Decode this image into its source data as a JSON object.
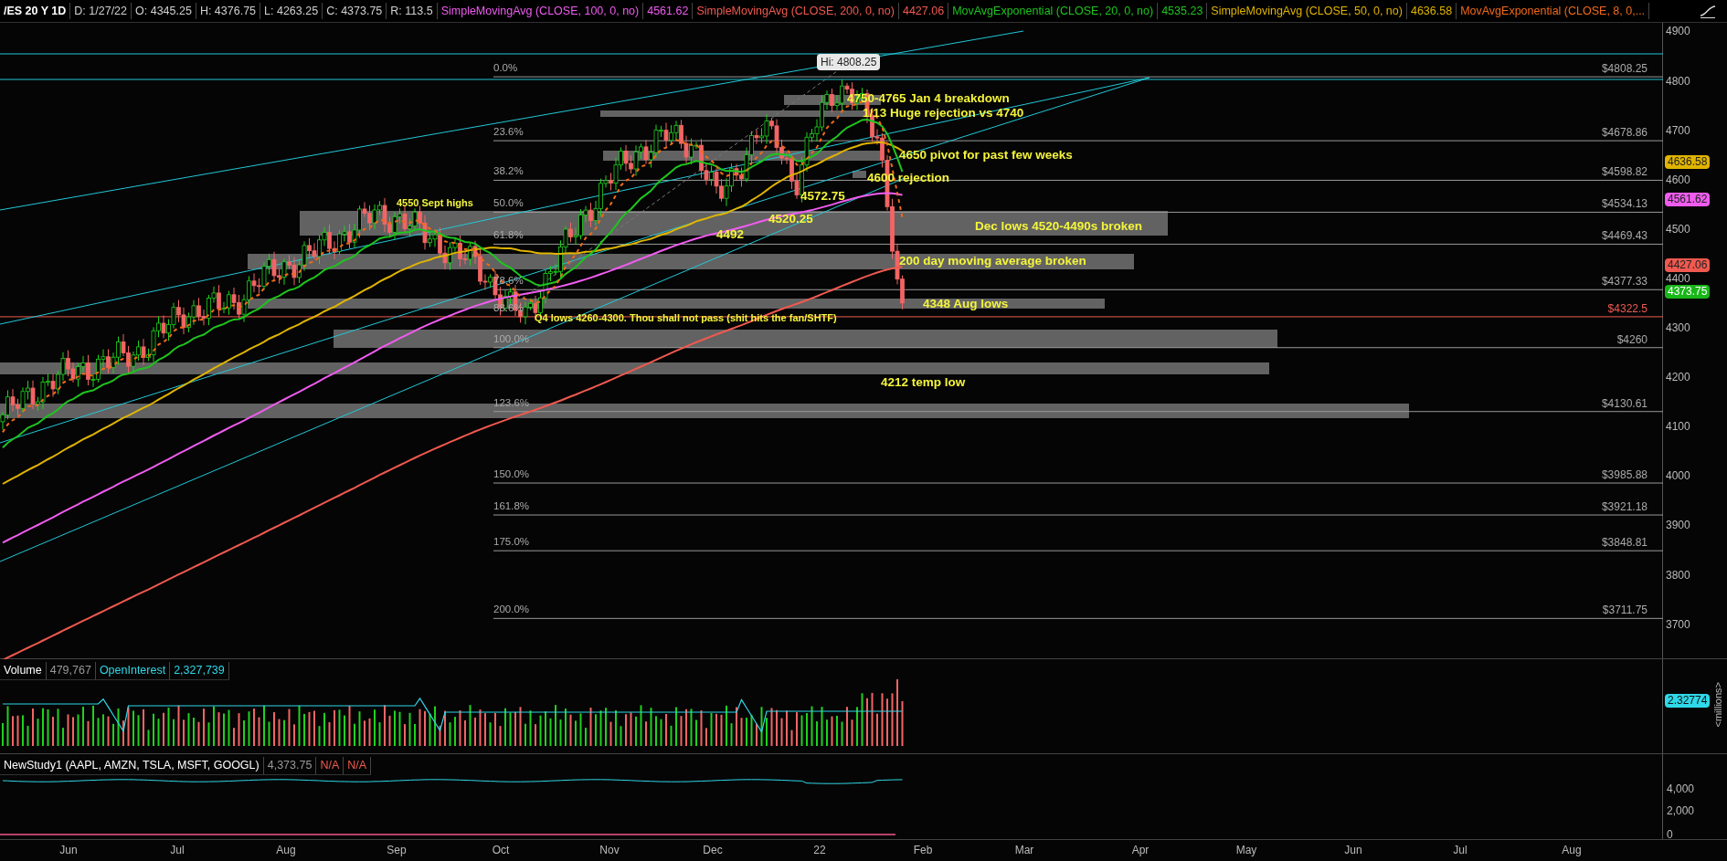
{
  "header": {
    "symbol": "/ES 20 Y 1D",
    "fields": [
      "D: 1/27/22",
      "O: 4345.25",
      "H: 4376.75",
      "L: 4263.25",
      "C: 4373.75",
      "R: 113.5"
    ],
    "studies": [
      {
        "name": "SimpleMovingAvg (CLOSE, 100, 0, no)",
        "value": "4561.62",
        "color": "#f05cf0"
      },
      {
        "name": "SimpleMovingAvg (CLOSE, 200, 0, no)",
        "value": "4427.06",
        "color": "#f0594f"
      },
      {
        "name": "MovAvgExponential (CLOSE, 20, 0, no)",
        "value": "4535.23",
        "color": "#1ec41e"
      },
      {
        "name": "SimpleMovingAvg (CLOSE, 50, 0, no)",
        "value": "4636.58",
        "color": "#e0b400"
      },
      {
        "name": "MovAvgExponential (CLOSE, 8, 0,...",
        "color": "#f06a1a"
      }
    ]
  },
  "price_chart": {
    "hi_label": "Hi: 4808.25",
    "fib_levels": [
      {
        "percent": "0.0%",
        "price": "$4808.25",
        "color": "#aaaaaa"
      },
      {
        "percent": "23.6%",
        "price": "$4678.86",
        "color": "#aaaaaa"
      },
      {
        "percent": "38.2%",
        "price": "$4598.82",
        "color": "#aaaaaa"
      },
      {
        "percent": "50.0%",
        "price": "$4534.13",
        "color": "#aaaaaa"
      },
      {
        "percent": "61.8%",
        "price": "$4469.43",
        "color": "#aaaaaa"
      },
      {
        "percent": "78.6%",
        "price": "$4377.33",
        "color": "#aaaaaa"
      },
      {
        "percent": "88.6%",
        "price": "$4322.5",
        "color": "#f05a50"
      },
      {
        "percent": "100.0%",
        "price": "$4260",
        "color": "#aaaaaa"
      },
      {
        "percent": "123.6%",
        "price": "$4130.61",
        "color": "#aaaaaa"
      },
      {
        "percent": "150.0%",
        "price": "$3985.88",
        "color": "#aaaaaa"
      },
      {
        "percent": "161.8%",
        "price": "$3921.18",
        "color": "#aaaaaa"
      },
      {
        "percent": "175.0%",
        "price": "$3848.81",
        "color": "#aaaaaa"
      },
      {
        "percent": "200.0%",
        "price": "$3711.75",
        "color": "#aaaaaa"
      }
    ],
    "annotations": [
      "4750-4765 Jan 4 breakdown",
      "1/13 Huge rejection vs 4740",
      "4650 pivot for past few weeks",
      "4600 rejection",
      "4572.75",
      "4550 Sept highs",
      "4520.25",
      "4492",
      "Dec lows 4520-4490s broken",
      "200 day moving average broken",
      "4348 Aug lows",
      "Q4 lows 4260-4300. Thou shall not pass (shit hits the fan/SHTF)",
      "4212 temp low"
    ],
    "axis_labels": [
      "4900",
      "4800",
      "4700",
      "4600",
      "4500",
      "4400",
      "4300",
      "4200",
      "4100",
      "4000",
      "3900",
      "3800",
      "3700"
    ],
    "axis_badges": [
      {
        "value": "4636.58",
        "color": "#e0b400"
      },
      {
        "value": "4561.62",
        "color": "#f05cf0"
      },
      {
        "value": "4427.06",
        "color": "#f0594f"
      },
      {
        "value": "4373.75",
        "color": "#19b619"
      }
    ]
  },
  "volume_panel": {
    "title": "Volume",
    "volume": "479,767",
    "oi_label": "OpenInterest",
    "oi_value": "2,327,739",
    "badge": "2.32774",
    "unit": "<millions>"
  },
  "study_panel": {
    "title": "NewStudy1 (AAPL, AMZN, TSLA, MSFT, GOOGL)",
    "value": "4,373.75",
    "fields": [
      "N/A",
      "N/A"
    ],
    "axis_labels": [
      "4,000",
      "2,000",
      "0"
    ]
  },
  "time_axis": [
    "Jun",
    "Jul",
    "Aug",
    "Sep",
    "Oct",
    "Nov",
    "Dec",
    "22",
    "Feb",
    "Mar",
    "Apr",
    "May",
    "Jun",
    "Jul",
    "Aug"
  ]
}
